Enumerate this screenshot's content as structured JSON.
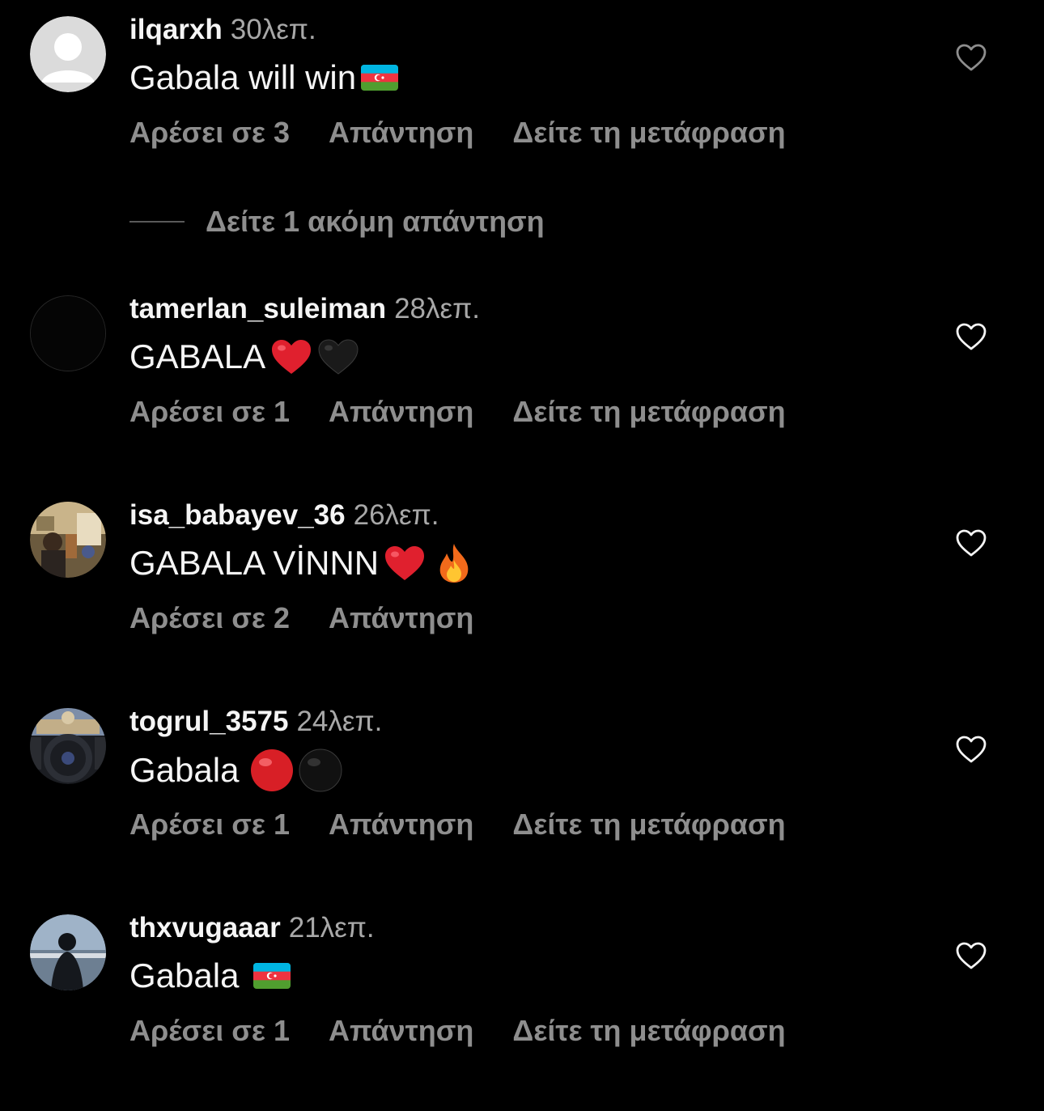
{
  "colors": {
    "background": "#000000",
    "primary_text": "#f5f5f5",
    "secondary_text": "#8e8e8e",
    "timestamp": "#a8a8a8"
  },
  "comments": [
    {
      "username": "ilqarxh",
      "time": "30λεπ.",
      "text": "Gabala will win",
      "emojis": [
        "azerbaijan-flag-emoji"
      ],
      "likes": "Αρέσει σε 3",
      "reply": "Απάντηση",
      "translate": "Δείτε τη μετάφραση",
      "avatar": "default-avatar-icon",
      "heart_icon": "heart-outline-icon"
    },
    {
      "username": "tamerlan_suleiman",
      "time": "28λεπ.",
      "text": "GABALA",
      "emojis": [
        "red-heart-emoji",
        "black-heart-emoji"
      ],
      "likes": "Αρέσει σε 1",
      "reply": "Απάντηση",
      "translate": "Δείτε τη μετάφραση",
      "avatar": "dark-avatar",
      "heart_icon": "heart-outline-icon"
    },
    {
      "username": "isa_babayev_36",
      "time": "26λεπ.",
      "text": "GABALA VİNNN",
      "emojis": [
        "red-heart-emoji",
        "fire-emoji"
      ],
      "likes": "Αρέσει σε 2",
      "reply": "Απάντηση",
      "translate": "",
      "avatar": "photo-avatar",
      "heart_icon": "heart-outline-icon"
    },
    {
      "username": "togrul_3575",
      "time": "24λεπ.",
      "text": "Gabala",
      "emojis": [
        "red-circle-emoji",
        "black-circle-emoji"
      ],
      "likes": "Αρέσει σε 1",
      "reply": "Απάντηση",
      "translate": "Δείτε τη μετάφραση",
      "avatar": "car-photo-avatar",
      "heart_icon": "heart-outline-icon"
    },
    {
      "username": "thxvugaaar",
      "time": "21λεπ.",
      "text": "Gabala",
      "emojis": [
        "azerbaijan-flag-emoji"
      ],
      "likes": "Αρέσει σε 1",
      "reply": "Απάντηση",
      "translate": "Δείτε τη μετάφραση",
      "avatar": "person-photo-avatar",
      "heart_icon": "heart-outline-icon"
    }
  ],
  "more_replies": "Δείτε 1 ακόμη απάντηση"
}
